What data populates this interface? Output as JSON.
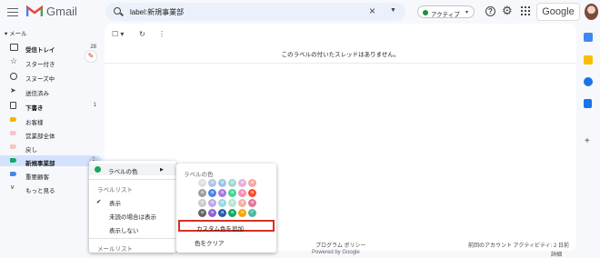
{
  "header": {
    "app_name": "Gmail",
    "search_query": "label:新規事業部",
    "status_label": "アクティブ",
    "account_brand": "Google"
  },
  "sidebar": {
    "section_label": "メール",
    "items": [
      {
        "label": "受信トレイ",
        "count": "28",
        "bold": true
      },
      {
        "label": "スター付き",
        "count": ""
      },
      {
        "label": "スヌーズ中",
        "count": ""
      },
      {
        "label": "送信済み",
        "count": ""
      },
      {
        "label": "下書き",
        "count": "1",
        "bold": true
      },
      {
        "label": "お客様",
        "count": ""
      },
      {
        "label": "営業部全体",
        "count": ""
      },
      {
        "label": "戻し",
        "count": ""
      },
      {
        "label": "新規事業部",
        "count": "",
        "bold": true,
        "selected": true
      },
      {
        "label": "重要顧客",
        "count": ""
      },
      {
        "label": "もっと見る",
        "count": ""
      }
    ],
    "label_colors": {
      "okyakusama": "#f4b400",
      "eigyobu": "#f6c6c6",
      "modoshi": "#f4c7c3",
      "shinki": "#16a765",
      "juyo": "#4a86e8"
    }
  },
  "main": {
    "empty_message": "このラベルの付いたスレッドはありません。",
    "footer_links": "プログラム ポリシー",
    "footer_powered": "Powered by Google",
    "footer_activity": "前回のアカウント アクティビティ: 2 日前",
    "footer_details": "詳細"
  },
  "context_menu": {
    "label_color": "ラベルの色",
    "label_list_header": "ラベルリスト",
    "show": "表示",
    "show_if_unread": "未読の場合は表示",
    "hide": "表示しない",
    "message_list_header": "メールリスト"
  },
  "color_submenu": {
    "title": "ラベルの色",
    "swatch_letter": "a",
    "add_custom": "カスタム色を追加",
    "clear_color": "色をクリア",
    "swatches": [
      "#e0e0e0",
      "#b3c6e7",
      "#a0c4e8",
      "#a5d6d3",
      "#e4b1d8",
      "#f7a7a3",
      "#9e9e9e",
      "#4a86e8",
      "#a479e2",
      "#42d692",
      "#f691b2",
      "#fb4c2f",
      "#cccccc",
      "#bfa8ea",
      "#98d7e4",
      "#b9e4d0",
      "#f2b2a8",
      "#e07798",
      "#666666",
      "#8e63ce",
      "#285bac",
      "#16a765",
      "#f2a60c",
      "#4fb9a0"
    ],
    "selected_index": 23
  }
}
